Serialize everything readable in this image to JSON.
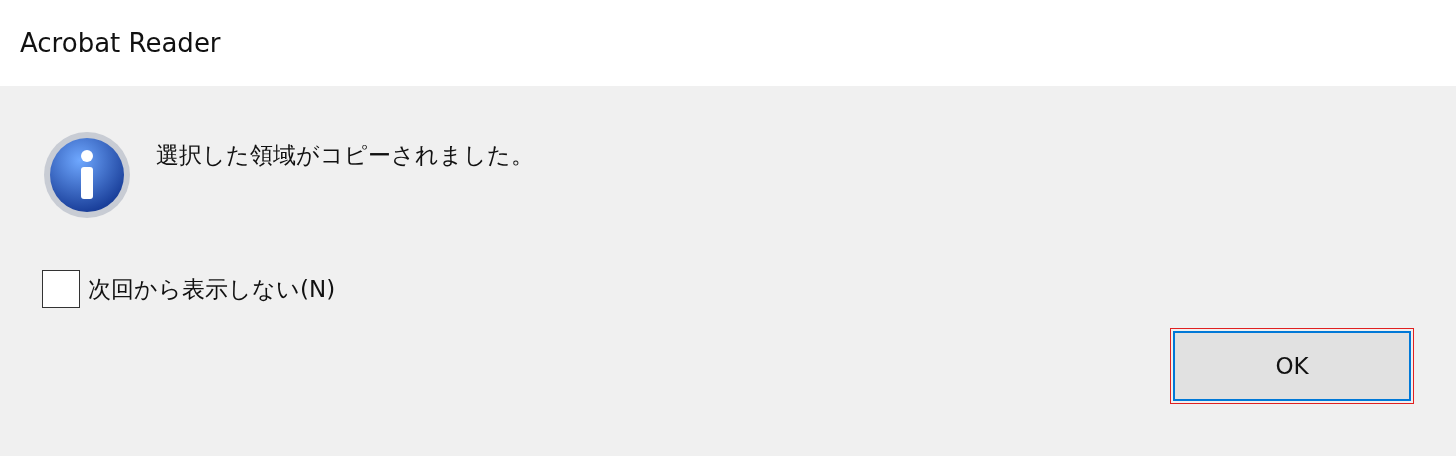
{
  "window": {
    "title": "Acrobat Reader"
  },
  "message": "選択した領域がコピーされました。",
  "checkbox": {
    "label": "次回から表示しない(N)",
    "checked": false
  },
  "buttons": [
    {
      "label": "OK",
      "selected": true
    }
  ]
}
